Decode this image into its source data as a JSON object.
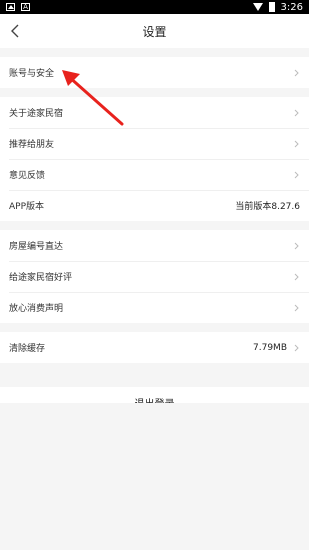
{
  "status_bar": {
    "time": "3:26"
  },
  "header": {
    "title": "设置"
  },
  "section1": {
    "items": [
      {
        "label": "账号与安全"
      }
    ]
  },
  "section2": {
    "items": [
      {
        "label": "关于途家民宿"
      },
      {
        "label": "推荐给朋友"
      },
      {
        "label": "意见反馈"
      },
      {
        "label": "APP版本",
        "value": "当前版本8.27.6"
      }
    ]
  },
  "section3": {
    "items": [
      {
        "label": "房屋编号直达"
      },
      {
        "label": "给途家民宿好评"
      },
      {
        "label": "放心消费声明"
      }
    ]
  },
  "section4": {
    "items": [
      {
        "label": "清除缓存",
        "value": "7.79MB"
      }
    ]
  },
  "logout": {
    "label": "退出登录"
  },
  "colors": {
    "arrow": "#e8221d",
    "background": "#f5f5f5"
  }
}
